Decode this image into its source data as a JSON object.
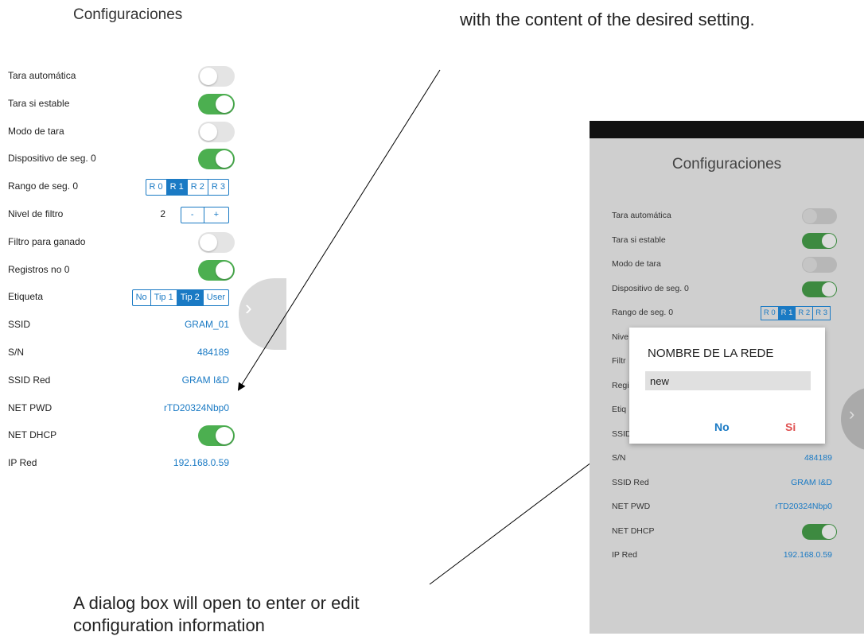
{
  "left_panel": {
    "title": "Configuraciones",
    "rows": [
      {
        "label": "Tara automática",
        "control": "toggle",
        "on": false
      },
      {
        "label": "Tara si estable",
        "control": "toggle",
        "on": true
      },
      {
        "label": "Modo de tara",
        "control": "toggle",
        "on": false
      },
      {
        "label": "Dispositivo de seg. 0",
        "control": "toggle",
        "on": true
      },
      {
        "label": "Rango de seg. 0",
        "control": "segmented",
        "options": [
          "R 0",
          "R 1",
          "R 2",
          "R 3"
        ],
        "selected": "R 1"
      },
      {
        "label": "Nivel de filtro",
        "control": "stepper",
        "value": "2",
        "minus": "-",
        "plus": "+"
      },
      {
        "label": "Filtro para ganado",
        "control": "toggle",
        "on": false
      },
      {
        "label": "Registros no 0",
        "control": "toggle",
        "on": true
      },
      {
        "label": "Etiqueta",
        "control": "segmented",
        "options": [
          "No",
          "Tip 1",
          "Tip 2",
          "User"
        ],
        "selected": "Tip 2"
      },
      {
        "label": "SSID",
        "control": "text",
        "value": "GRAM_01"
      },
      {
        "label": "S/N",
        "control": "text",
        "value": "484189"
      },
      {
        "label": "SSID Red",
        "control": "text",
        "value": "GRAM I&D"
      },
      {
        "label": "NET PWD",
        "control": "text",
        "value": "rTD20324Nbp0"
      },
      {
        "label": "NET DHCP",
        "control": "toggle",
        "on": true
      },
      {
        "label": "IP Red",
        "control": "text",
        "value": "192.168.0.59"
      }
    ],
    "side_handle_icon": "chevron-right-icon"
  },
  "captions": {
    "top": "with the content of the desired setting.",
    "bottom_line1": "A dialog box will open to enter or edit",
    "bottom_line2": "configuration information"
  },
  "phone": {
    "title": "Configuraciones",
    "rows": [
      {
        "label": "Tara automática",
        "control": "toggle",
        "on": false
      },
      {
        "label": "Tara si estable",
        "control": "toggle",
        "on": true
      },
      {
        "label": "Modo de tara",
        "control": "toggle",
        "on": false
      },
      {
        "label": "Dispositivo de seg. 0",
        "control": "toggle",
        "on": true
      },
      {
        "label": "Rango de seg. 0",
        "control": "segmented",
        "options": [
          "R 0",
          "R 1",
          "R 2",
          "R 3"
        ],
        "selected": "R 1"
      },
      {
        "label": "Nive",
        "control": "none"
      },
      {
        "label": "Filtr",
        "control": "none"
      },
      {
        "label": "Regi",
        "control": "none"
      },
      {
        "label": "Etiq",
        "control": "none"
      },
      {
        "label": "SSID",
        "control": "none"
      },
      {
        "label": "S/N",
        "control": "text",
        "value": "484189"
      },
      {
        "label": "SSID Red",
        "control": "text",
        "value": "GRAM I&D"
      },
      {
        "label": "NET PWD",
        "control": "text",
        "value": "rTD20324Nbp0"
      },
      {
        "label": "NET DHCP",
        "control": "toggle",
        "on": true
      },
      {
        "label": "IP Red",
        "control": "text",
        "value": "192.168.0.59"
      }
    ],
    "dialog": {
      "title": "NOMBRE DE LA REDE",
      "input_value": "new",
      "no_label": "No",
      "si_label": "Si"
    }
  },
  "colors": {
    "accent_blue": "#1a7ac4",
    "toggle_on": "#4caf50",
    "cancel_red": "#e05252"
  }
}
